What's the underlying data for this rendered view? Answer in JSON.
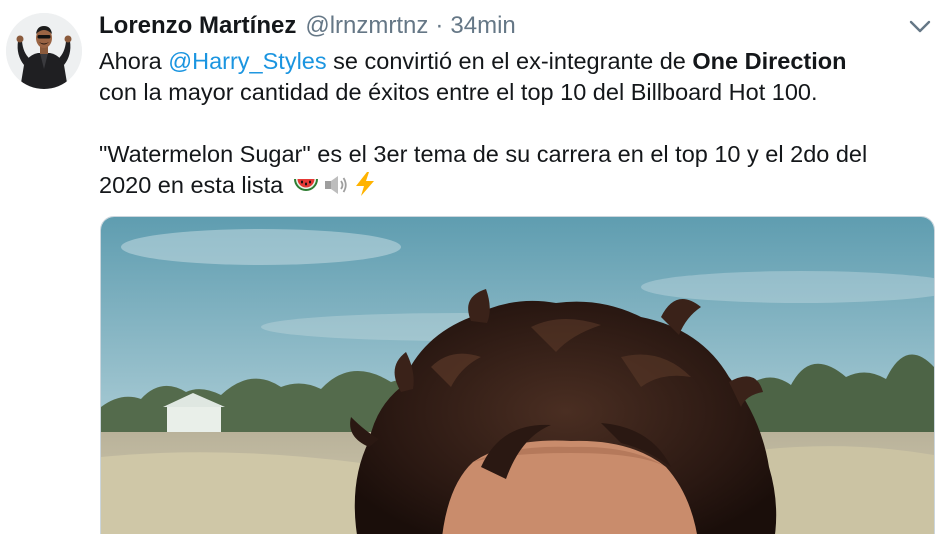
{
  "tweet": {
    "author": {
      "display_name": "Lorenzo Martínez",
      "handle": "@lrnzmrtnz"
    },
    "separator": "·",
    "timestamp": "34min",
    "text": {
      "line1_pre": "Ahora ",
      "mention": "@Harry_Styles",
      "line1_mid": " se convirtió en el ex-integrante de ",
      "line1_bold": "One Direction",
      "line2": "con la mayor cantidad de éxitos entre el top 10 del Billboard Hot 100.",
      "line3": "\"Watermelon Sugar\" es el 3er tema de su carrera en el top 10 y el 2do del",
      "line4": "2020 en esta lista"
    },
    "emojis": [
      "watermelon-emoji",
      "speaker-emoji",
      "lightning-emoji"
    ],
    "media": {
      "type": "photo",
      "subject": "man with curly hair in front of sky and trees"
    },
    "icons": {
      "caret": "chevron-down-icon",
      "avatar": "avatar"
    },
    "colors": {
      "link": "#1b95e0",
      "secondary_text": "#657786",
      "primary_text": "#14171a",
      "border": "#ccd6dd"
    }
  }
}
